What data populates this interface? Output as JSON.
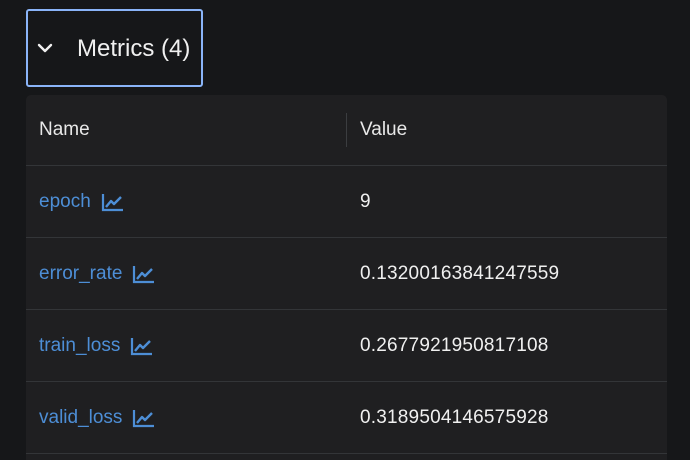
{
  "section": {
    "title": "Metrics (4)",
    "toggle_icon": "chevron-down-icon"
  },
  "table": {
    "headers": {
      "name": "Name",
      "value": "Value"
    },
    "rows": [
      {
        "name": "epoch",
        "value": "9",
        "icon": "line-chart-icon"
      },
      {
        "name": "error_rate",
        "value": "0.13200163841247559",
        "icon": "line-chart-icon"
      },
      {
        "name": "train_loss",
        "value": "0.2677921950817108",
        "icon": "line-chart-icon"
      },
      {
        "name": "valid_loss",
        "value": "0.3189504146575928",
        "icon": "line-chart-icon"
      }
    ]
  },
  "colors": {
    "background": "#161719",
    "table_background": "#1f1f21",
    "link": "#4d8ed6",
    "focus_border": "#8ab4f8",
    "text": "#f0f0f0"
  }
}
